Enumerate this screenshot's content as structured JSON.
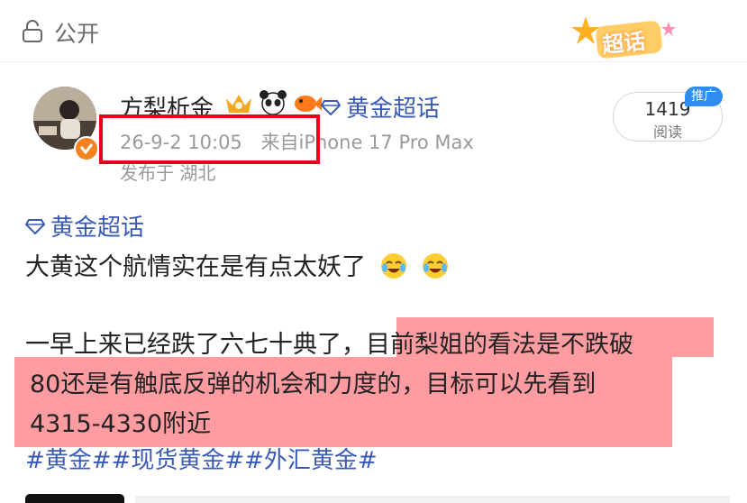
{
  "header": {
    "visibility_label": "公开",
    "supertopic_badge_label": "超话"
  },
  "post": {
    "author": {
      "name": "方梨析金",
      "badges": [
        "crown-badge",
        "panda-badge",
        "fish-badge"
      ],
      "verified": true
    },
    "topic_link": "黄金超话",
    "meta": {
      "date": "26-9-2 10:05",
      "source": "来自iPhone 17 Pro Max",
      "location": "发布于 湖北"
    },
    "reads": {
      "count": "1419",
      "label": "阅读",
      "promo_tag": "推广"
    },
    "body": {
      "topic": "黄金超话",
      "line1": "大黄这个航情实在是有点太妖了",
      "line2_normal": "一早上来已经跌了六七十典了，",
      "line2_highlight": "目前梨姐的看法是不跌破",
      "line3": "80还是有触底反弹的机会和力度的，目标可以先看到",
      "line4": "4315-4330附近",
      "hashtags": "#黄金##现货黄金##外汇黄金#"
    }
  },
  "colors": {
    "link": "#3a5ab8",
    "highlight": "#ff5f69",
    "annotation_box": "#e4001c",
    "verified": "#f58220",
    "promo": "#2f8cf0"
  }
}
